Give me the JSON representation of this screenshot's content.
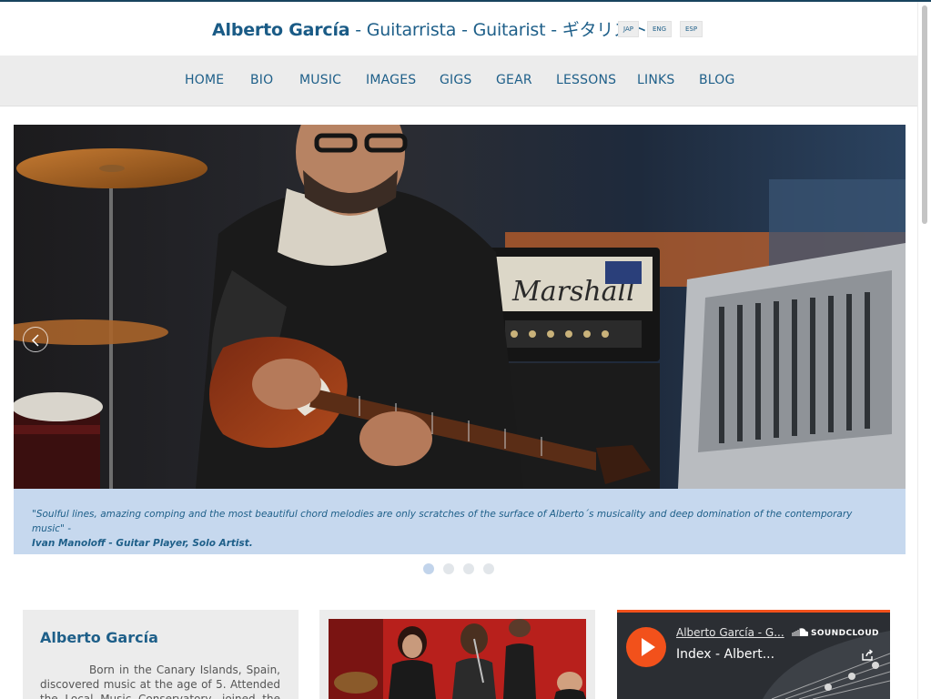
{
  "header": {
    "name": "Alberto García",
    "subtitle": " - Guitarrista - Guitarist - ギタリスト",
    "languages": [
      "JAP",
      "ENG",
      "ESP"
    ]
  },
  "nav": {
    "items": [
      "HOME",
      "BIO",
      "MUSIC",
      "IMAGES",
      "GIGS",
      "GEAR",
      "LESSONS",
      "LINKS",
      "BLOG"
    ]
  },
  "slider": {
    "amp_brand": "Marshall",
    "quote": "\"Soulful lines, amazing comping and the most beautiful chord melodies are only scratches of the surface of Alberto´s musicality and deep domination of the contemporary music\" -",
    "author": "Ivan Manoloff - Guitar Player, Solo Artist.",
    "slide_count": 4,
    "active_slide": 1
  },
  "bio": {
    "title": "Alberto García",
    "text": "Born in the Canary Islands, Spain, discovered music at the age of 5. Attended the Local Music Conservatory, joined the Yamaha"
  },
  "soundcloud": {
    "artist": "Alberto García - G...",
    "track": "Index - Albert...",
    "logo_text": "SOUNDCLOUD",
    "accent": "#f2511b"
  },
  "colors": {
    "brand": "#1e5f89",
    "nav_bg": "#ececec",
    "caption_bg": "#c6d8ee"
  }
}
